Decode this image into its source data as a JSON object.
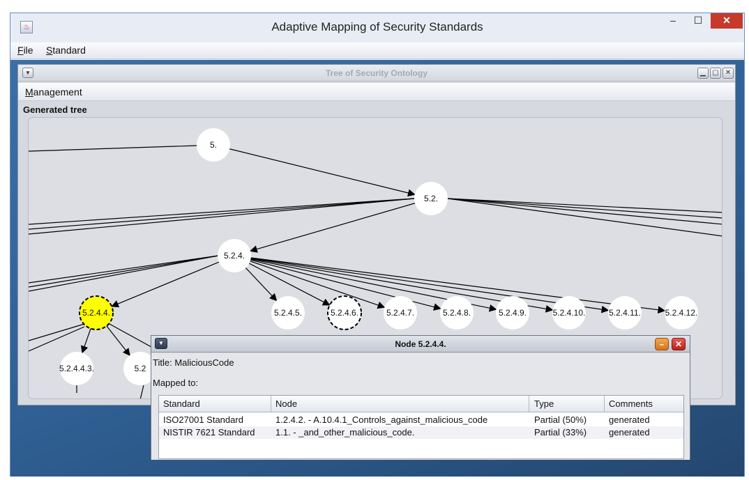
{
  "window": {
    "title": "Adaptive Mapping of Security Standards",
    "app_icon": "java-cup-icon",
    "buttons": {
      "minimize": "–",
      "maximize": "☐",
      "close": "✕"
    }
  },
  "menubar": {
    "items": [
      {
        "label": "File",
        "mnemonic": "F",
        "rest": "ile"
      },
      {
        "label": "Standard",
        "mnemonic": "S",
        "rest": "tandard"
      }
    ]
  },
  "tree_frame": {
    "title": "Tree of Security Ontology",
    "menu": {
      "mnemonic": "M",
      "rest": "anagement",
      "label": "Management"
    },
    "panel_title": "Generated tree",
    "nodes": [
      {
        "id": "5.",
        "label": "5."
      },
      {
        "id": "5.2.",
        "label": "5.2."
      },
      {
        "id": "5.2.4.",
        "label": "5.2.4."
      },
      {
        "id": "5.2.4.4.",
        "label": "5.2.4.4.",
        "state": "selected"
      },
      {
        "id": "5.2.4.5.",
        "label": "5.2.4.5."
      },
      {
        "id": "5.2.4.6.",
        "label": "5.2.4.6.",
        "state": "dashed"
      },
      {
        "id": "5.2.4.7.",
        "label": "5.2.4.7."
      },
      {
        "id": "5.2.4.8.",
        "label": "5.2.4.8."
      },
      {
        "id": "5.2.4.9.",
        "label": "5.2.4.9."
      },
      {
        "id": "5.2.4.10.",
        "label": "5.2.4.10."
      },
      {
        "id": "5.2.4.11.",
        "label": "5.2.4.11."
      },
      {
        "id": "5.2.4.12.",
        "label": "5.2.4.12."
      },
      {
        "id": "5.2.4.4.3.",
        "label": "5.2.4.4.3."
      },
      {
        "id": "5.2.4.4.x",
        "label": "5.2"
      }
    ],
    "colors": {
      "selected_fill": "#ffff00",
      "node_fill": "#ffffff",
      "edge": "#000000"
    }
  },
  "node_dialog": {
    "title": "Node 5.2.4.4.",
    "title_label": "Title:",
    "title_value": "MaliciousCode",
    "mapped_label": "Mapped to:",
    "columns": [
      "Standard",
      "Node",
      "Type",
      "Comments"
    ],
    "rows": [
      {
        "standard": "ISO27001 Standard",
        "node": "1.2.4.2. - A.10.4.1_Controls_against_malicious_code",
        "type": "Partial (50%)",
        "comments": "generated"
      },
      {
        "standard": "NISTIR 7621 Standard",
        "node": "1.1. - _and_other_malicious_code.",
        "type": "Partial (33%)",
        "comments": "generated"
      }
    ]
  }
}
